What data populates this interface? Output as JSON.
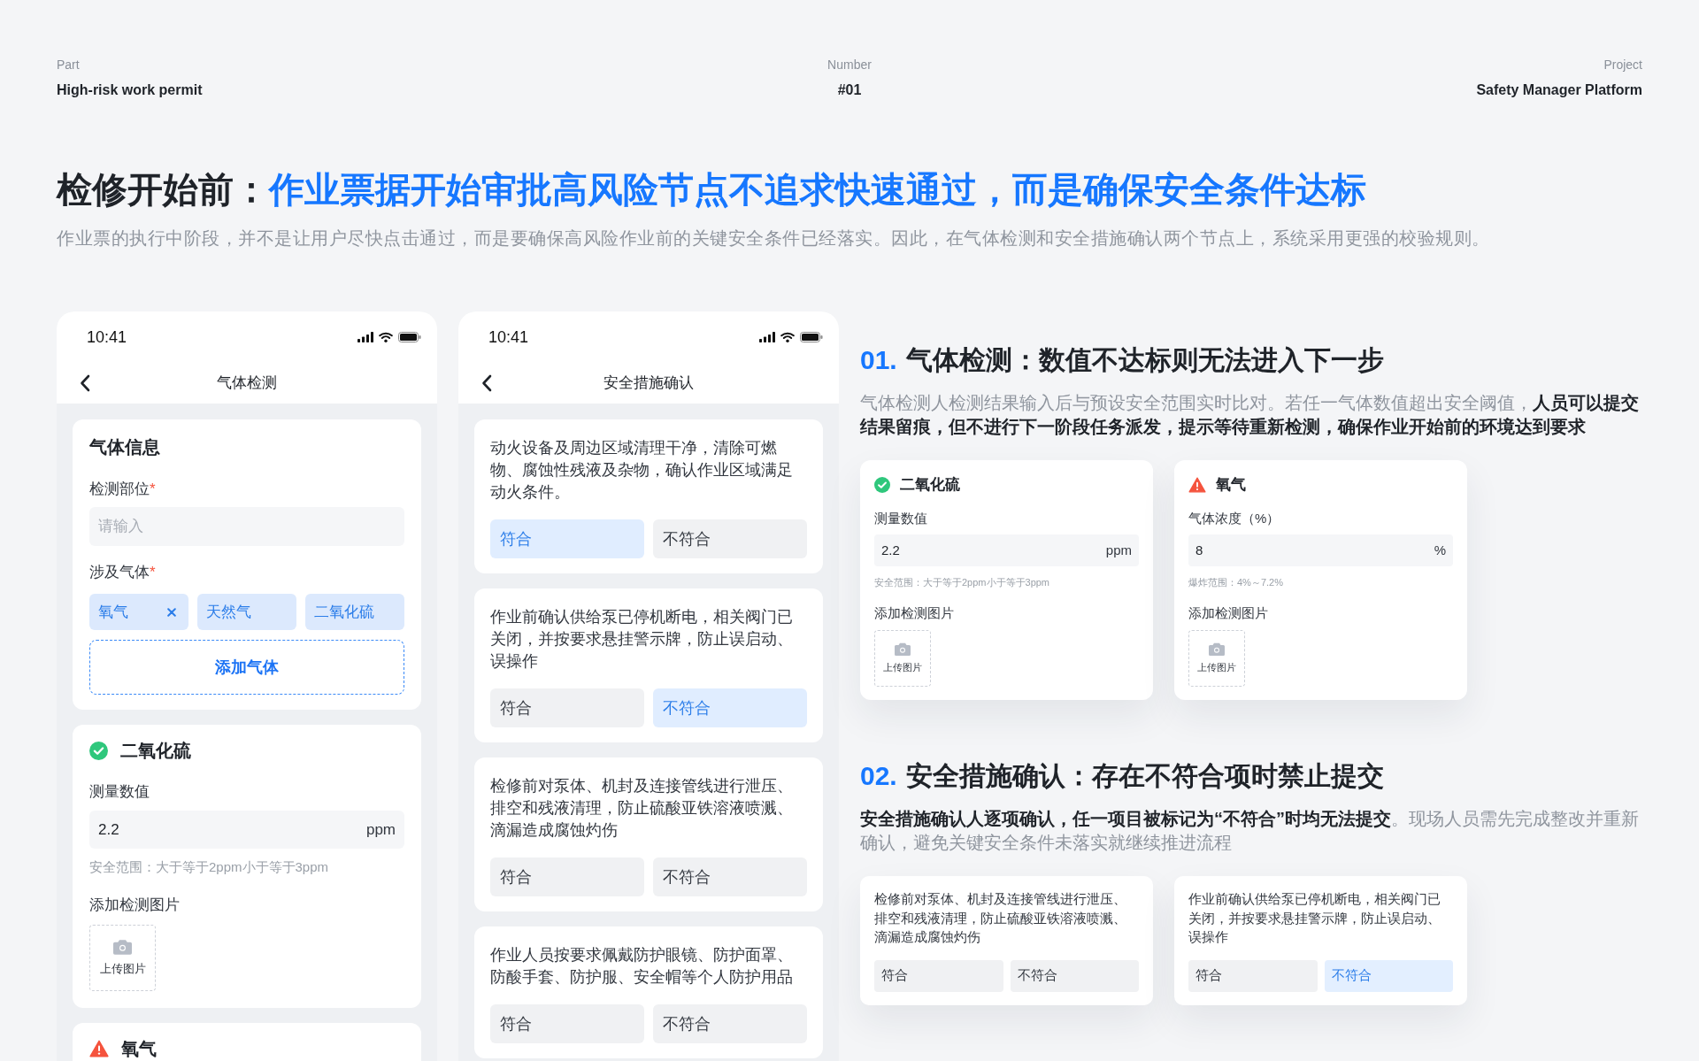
{
  "meta": [
    {
      "label": "Part",
      "value": "High-risk work permit"
    },
    {
      "label": "Number",
      "value": "#01"
    },
    {
      "label": "Project",
      "value": "Safety Manager Platform"
    }
  ],
  "hero": {
    "title_lead": "检修开始前：",
    "title_highlight": "作业票据开始审批高风险节点不追求快速通过，而是确保安全条件达标",
    "subtitle": "作业票的执行中阶段，并不是让用户尽快点击通过，而是要确保高风险作业前的关键安全条件已经落实。因此，在气体检测和安全措施确认两个节点上，系统采用更强的校验规则。"
  },
  "phones": [
    {
      "time": "10:41",
      "nav_title": "气体检测",
      "cards": [
        {
          "kind": "form",
          "title": "气体信息",
          "fields": [
            {
              "kind": "text",
              "label": "检测部位",
              "required_mark": "*",
              "placeholder": "请输入"
            },
            {
              "kind": "tags",
              "label": "涉及气体",
              "required_mark": "*",
              "tags": [
                {
                  "label": "氧气",
                  "removable": true
                },
                {
                  "label": "天然气",
                  "removable": false
                },
                {
                  "label": "二氧化硫",
                  "removable": false
                }
              ],
              "add_button": "添加气体"
            }
          ]
        },
        {
          "kind": "gas",
          "in_range": true,
          "name": "二氧化硫",
          "field_label": "测量数值",
          "value": "2.2",
          "unit": "ppm",
          "hint": "安全范围：大于等于2ppm小于等于3ppm",
          "upload_label": "添加检测图片",
          "upload_button": "上传图片"
        },
        {
          "kind": "gas",
          "in_range": false,
          "name": "氧气"
        }
      ]
    },
    {
      "time": "10:41",
      "nav_title": "安全措施确认",
      "cards": [
        {
          "kind": "measure",
          "text": "动火设备及周边区域清理干净，清除可燃物、腐蚀性残液及杂物，确认作业区域满足动火条件。",
          "options": [
            {
              "label": "符合",
              "selected": true
            },
            {
              "label": "不符合",
              "selected": false
            }
          ]
        },
        {
          "kind": "measure",
          "text": "作业前确认供给泵已停机断电，相关阀门已关闭，并按要求悬挂警示牌，防止误启动、误操作",
          "options": [
            {
              "label": "符合",
              "selected": false
            },
            {
              "label": "不符合",
              "selected": true
            }
          ]
        },
        {
          "kind": "measure",
          "text": "检修前对泵体、机封及连接管线进行泄压、排空和残液清理，防止硫酸亚铁溶液喷溅、滴漏造成腐蚀灼伤",
          "options": [
            {
              "label": "符合",
              "selected": false
            },
            {
              "label": "不符合",
              "selected": false
            }
          ]
        },
        {
          "kind": "measure",
          "text": "作业人员按要求佩戴防护眼镜、防护面罩、防酸手套、防护服、安全帽等个人防护用品",
          "options": [
            {
              "label": "符合",
              "selected": false
            },
            {
              "label": "不符合",
              "selected": false
            }
          ]
        }
      ]
    }
  ],
  "sections": [
    {
      "number": "01.",
      "title": "气体检测：数值不达标则无法进入下一步",
      "description": "气体检测人检测结果输入后与预设安全范围实时比对。若任一气体数值超出安全阈值，**人员可以提交结果留痕，但不进行下一阶段任务派发，提示等待重新检测，确保作业开始前的环境达到要求**",
      "cards": [
        {
          "kind": "gas",
          "in_range": true,
          "name": "二氧化硫",
          "field_label": "测量数值",
          "value": "2.2",
          "unit": "ppm",
          "hint": "安全范围：大于等于2ppm小于等于3ppm",
          "upload_label": "添加检测图片",
          "upload_button": "上传图片"
        },
        {
          "kind": "gas",
          "in_range": false,
          "name": "氧气",
          "field_label": "气体浓度（%）",
          "value": "8",
          "unit": "%",
          "hint": "爆炸范围：4%～7.2%",
          "upload_label": "添加检测图片",
          "upload_button": "上传图片"
        }
      ]
    },
    {
      "number": "02.",
      "title": "安全措施确认：存在不符合项时禁止提交",
      "description": "**安全措施确认人逐项确认，任一项目被标记为“不符合”时均无法提交**。现场人员需先完成整改并重新确认，避免关键安全条件未落实就继续推进流程",
      "cards": [
        {
          "kind": "measure",
          "text": "检修前对泵体、机封及连接管线进行泄压、排空和残液清理，防止硫酸亚铁溶液喷溅、滴漏造成腐蚀灼伤",
          "options": [
            {
              "label": "符合",
              "selected": false
            },
            {
              "label": "不符合",
              "selected": false
            }
          ]
        },
        {
          "kind": "measure",
          "text": "作业前确认供给泵已停机断电，相关阀门已关闭，并按要求悬挂警示牌，防止误启动、误操作",
          "options": [
            {
              "label": "符合",
              "selected": false
            },
            {
              "label": "不符合",
              "selected": true
            }
          ]
        }
      ]
    }
  ]
}
